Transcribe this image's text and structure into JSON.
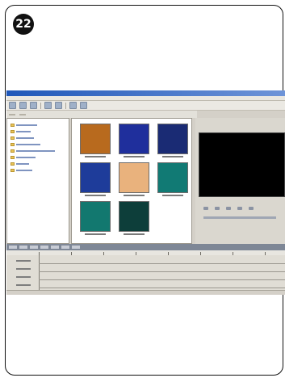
{
  "page": {
    "step_number": "22"
  },
  "app": {
    "window_title": "",
    "menu": [
      "",
      "",
      "",
      "",
      "",
      "",
      "",
      ""
    ],
    "pane_tabs": [
      "",
      ""
    ]
  },
  "colors": {
    "titlebar": "#1f57b9",
    "preview_screen": "#000000",
    "thumbnail_1": "#b86a1e",
    "thumbnail_2": "#1f2f9c",
    "thumbnail_3": "#1a2b74",
    "thumbnail_4": "#1e3c9a",
    "thumbnail_5": "#e9b27d",
    "thumbnail_6": "#117a74",
    "thumbnail_7": "#12786f",
    "thumbnail_8": "#0d3e3a"
  },
  "thumbnails": [
    {
      "name": "thumbnail-1",
      "color": "#b86a1e"
    },
    {
      "name": "thumbnail-2",
      "color": "#1f2f9c"
    },
    {
      "name": "thumbnail-3",
      "color": "#1a2b74"
    },
    {
      "name": "thumbnail-4",
      "color": "#1e3c9a"
    },
    {
      "name": "thumbnail-5",
      "color": "#e9b27d"
    },
    {
      "name": "thumbnail-6",
      "color": "#117a74"
    },
    {
      "name": "thumbnail-7",
      "color": "#12786f"
    },
    {
      "name": "thumbnail-8",
      "color": "#0d3e3a"
    }
  ]
}
